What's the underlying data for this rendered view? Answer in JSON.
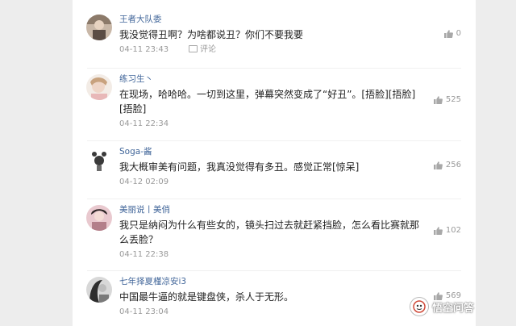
{
  "comments": [
    {
      "username": "王者大队委",
      "text": "我没觉得丑啊？为啥都说丑？你们不要我要",
      "time": "04-11 23:43",
      "reply_label": "评论",
      "likes": "0"
    },
    {
      "username": "练习生丶",
      "text": "在现场，哈哈哈。一切到这里，弹幕突然变成了“好丑”。[捂脸][捂脸][捂脸]",
      "time": "04-11 22:34",
      "likes": "525"
    },
    {
      "username": "Soga-酱",
      "text": "我大概审美有问题，我真没觉得有多丑。感觉正常[惊呆]",
      "time": "04-12 02:09",
      "likes": "256"
    },
    {
      "username": "美丽说丨美俏",
      "text": "我只是纳闷为什么有些女的，镜头扫过去就赶紧挡脸，怎么看比赛就那么丢脸？",
      "time": "04-11 22:38",
      "likes": "102"
    },
    {
      "username": "七年择夏槿凉安i3",
      "text": "中国最牛逼的就是键盘侠，杀人于无形。",
      "time": "04-11 23:04",
      "likes": "569"
    }
  ],
  "watermark": {
    "text": "悟空问答",
    "icon": "wukong-logo-icon"
  },
  "colors": {
    "username": "#406599",
    "text": "#222222",
    "meta": "#999999",
    "background": "#ededed",
    "panel": "#ffffff"
  }
}
